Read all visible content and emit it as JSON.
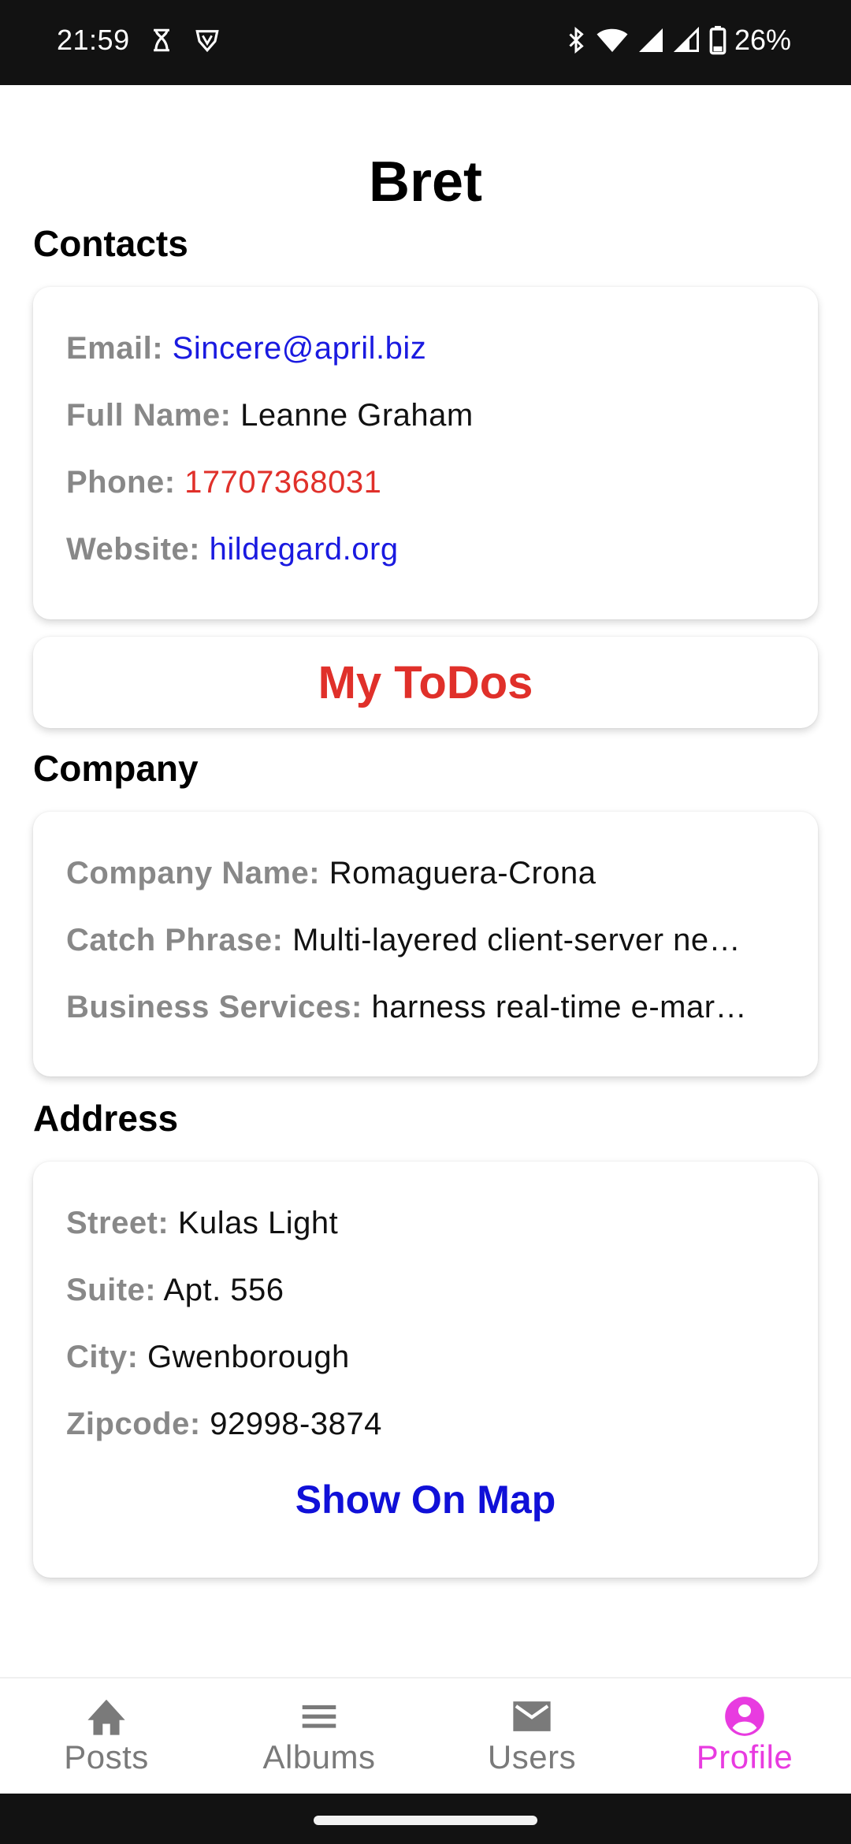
{
  "status_bar": {
    "time": "21:59",
    "battery": "26%",
    "icons": [
      "hourglass-icon",
      "vpn-shield-icon",
      "bluetooth-icon",
      "wifi-icon",
      "signal-icon",
      "signal-icon",
      "battery-icon"
    ]
  },
  "profile": {
    "username": "Bret"
  },
  "contacts": {
    "section_title": "Contacts",
    "email_label": "Email:",
    "email": "Sincere@april.biz",
    "full_name_label": "Full Name:",
    "full_name": "Leanne Graham",
    "phone_label": "Phone:",
    "phone": "17707368031",
    "website_label": "Website:",
    "website": "hildegard.org"
  },
  "todos": {
    "label": "My ToDos"
  },
  "company": {
    "section_title": "Company",
    "name_label": "Company Name:",
    "name": "Romaguera-Crona",
    "catch_phrase_label": "Catch Phrase:",
    "catch_phrase": "Multi-layered client-server ne…",
    "bs_label": "Business Services:",
    "bs": "harness real-time e-mar…"
  },
  "address": {
    "section_title": "Address",
    "street_label": "Street:",
    "street": "Kulas Light",
    "suite_label": "Suite:",
    "suite": "Apt. 556",
    "city_label": "City:",
    "city": "Gwenborough",
    "zipcode_label": "Zipcode:",
    "zipcode": "92998-3874",
    "map_button": "Show On Map"
  },
  "bottom_nav": {
    "items": [
      {
        "label": "Posts",
        "icon": "home-icon"
      },
      {
        "label": "Albums",
        "icon": "menu-icon"
      },
      {
        "label": "Users",
        "icon": "mail-icon"
      },
      {
        "label": "Profile",
        "icon": "account-circle-icon"
      }
    ],
    "active": "Profile"
  },
  "colors": {
    "link": "#1a1ae0",
    "phone": "#e0302a",
    "todos": "#e0302a",
    "map_button": "#1010d8",
    "nav_active": "#e83be0",
    "nav_inactive": "#7a7a7a",
    "label": "#888888"
  }
}
